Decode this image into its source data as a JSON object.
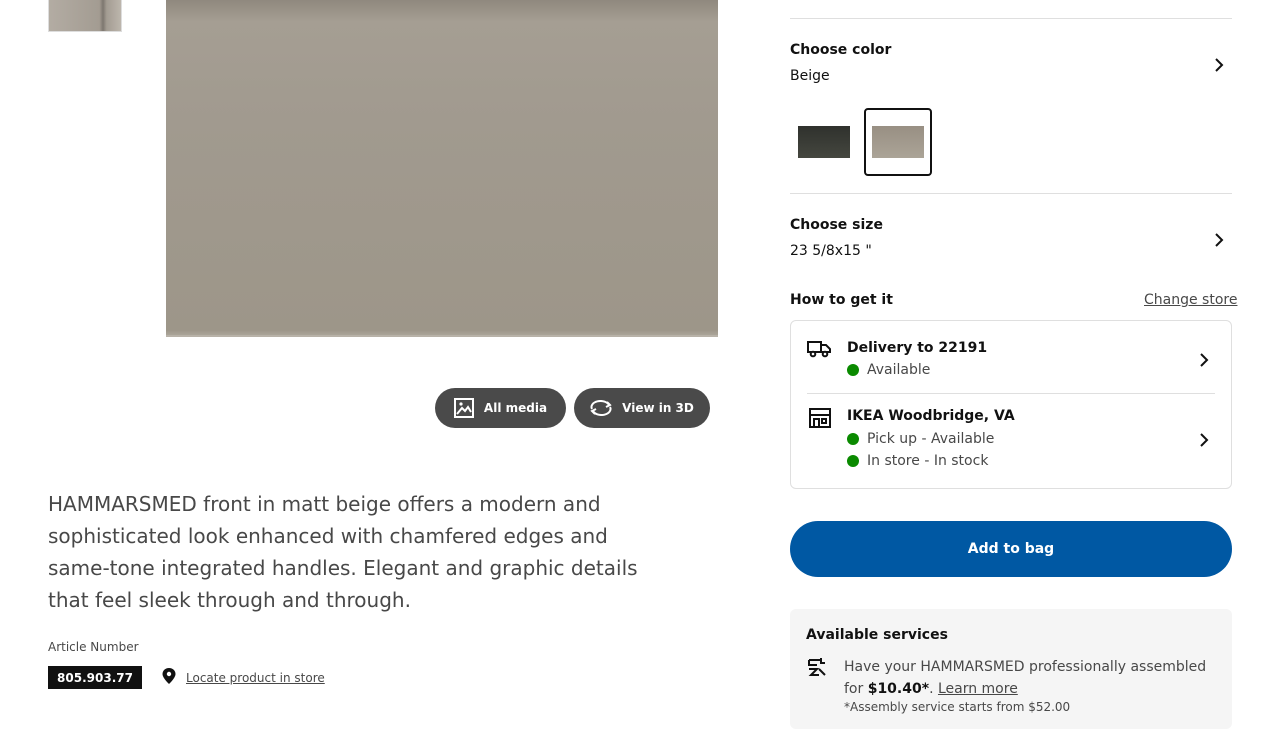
{
  "gallery": {
    "all_media_label": "All media",
    "view_3d_label": "View in 3D"
  },
  "product": {
    "description": "HAMMARSMED front in matt beige offers a modern and sophisticated look enhanced with chamfered edges and same-tone integrated handles. Elegant and graphic details that feel sleek through and through.",
    "article_label": "Article Number",
    "article_number": "805.903.77",
    "locate_label": "Locate product in store"
  },
  "color": {
    "title": "Choose color",
    "value": "Beige",
    "swatches": [
      {
        "name": "Dark gray",
        "color": "#3d3f3b"
      },
      {
        "name": "Beige",
        "color": "#a8a196",
        "selected": true
      }
    ]
  },
  "size": {
    "title": "Choose size",
    "value": "23 5/8x15 \""
  },
  "availability": {
    "title": "How to get it",
    "change_store": "Change store",
    "delivery": {
      "title": "Delivery to 22191",
      "status": "Available"
    },
    "store": {
      "title": "IKEA Woodbridge, VA",
      "pickup": "Pick up - Available",
      "instore": "In store - In stock"
    },
    "status_color": "#0a8a00"
  },
  "cart": {
    "add_label": "Add to bag",
    "accent": "#0058a3"
  },
  "services": {
    "title": "Available services",
    "text_prefix": "Have your HAMMARSMED professionally assembled for",
    "price": "$10.40*",
    "learn_more": "Learn more",
    "footnote": "*Assembly service starts from $52.00"
  }
}
